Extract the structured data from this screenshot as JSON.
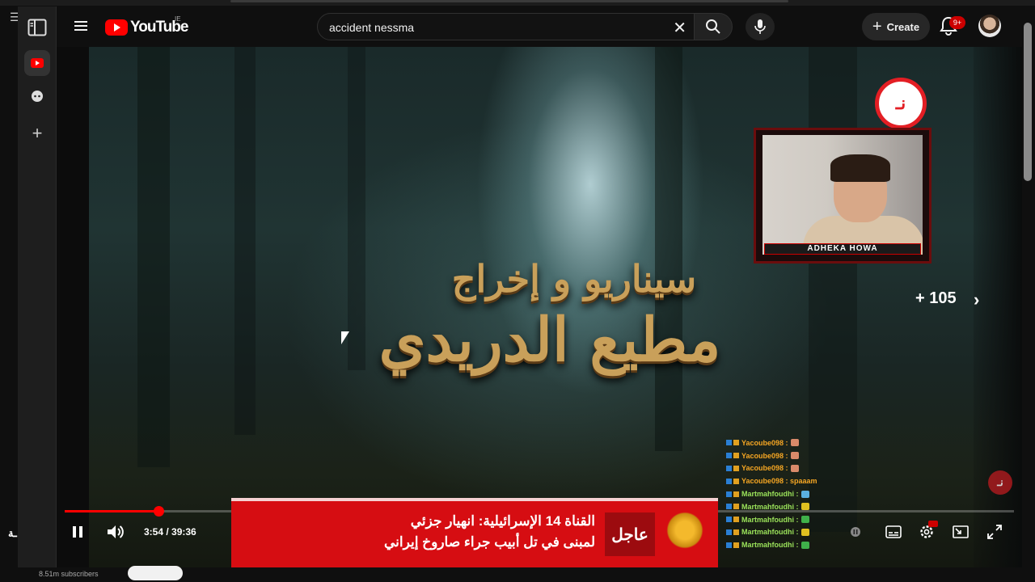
{
  "browser": {
    "sidebar_icons": [
      "panel-icon",
      "youtube-app-icon",
      "game-icon",
      "add-icon"
    ]
  },
  "header": {
    "logo_text": "YouTube",
    "country_code": "IE",
    "search_query": "accident nessma",
    "create_label": "Create",
    "notifications_badge": "9+"
  },
  "video": {
    "title_line1": "سيناريو و إخراج",
    "title_line2": "مطيع الدريدي",
    "channel_logo_text": "نـ",
    "streamer_label": "ADHEKA HOWA",
    "more_count": "+ 105",
    "watermark": "نـ",
    "time_current": "3:54",
    "time_total": "39:36",
    "time_display": "3:54 / 39:36",
    "progress_fraction": 0.0986
  },
  "chat": {
    "messages": [
      {
        "user": "Yacoube098",
        "text": "",
        "color": "#f5a623",
        "emoji": "#d98a6a"
      },
      {
        "user": "Yacoube098",
        "text": "",
        "color": "#f5a623",
        "emoji": "#d98a6a"
      },
      {
        "user": "Yacoube098",
        "text": "",
        "color": "#f5a623",
        "emoji": "#d98a6a"
      },
      {
        "user": "Yacoube098",
        "text": "spaaam",
        "color": "#f5a623",
        "emoji": ""
      },
      {
        "user": "Martmahfoudhi",
        "text": "",
        "color": "#9be35a",
        "emoji": "#5ab0e0"
      },
      {
        "user": "Martmahfoudhi",
        "text": "",
        "color": "#9be35a",
        "emoji": "#e0c020"
      },
      {
        "user": "Martmahfoudhi",
        "text": "",
        "color": "#9be35a",
        "emoji": "#3fb04a"
      },
      {
        "user": "Martmahfoudhi",
        "text": "",
        "color": "#9be35a",
        "emoji": "#e0c020"
      },
      {
        "user": "Martmahfoudhi",
        "text": "",
        "color": "#9be35a",
        "emoji": "#3fb04a"
      }
    ]
  },
  "news_ticker": {
    "tag": "عاجل",
    "line1": "القناة 14 الإسرائيلية: انهيار جزئي",
    "line2": "لمبنى في تل أبيب جراء صاروخ إيراني"
  },
  "below": {
    "subscribers": "8.51m subscribers"
  },
  "colors": {
    "accent": "#ff0000",
    "news_red": "#d60d12",
    "badge": "#cc0000"
  }
}
